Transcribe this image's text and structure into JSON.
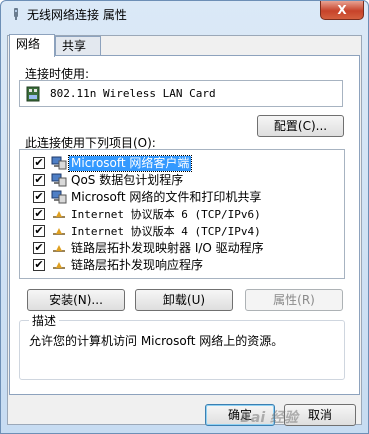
{
  "window": {
    "title": "无线网络连接 属性",
    "close_label": "X"
  },
  "tabs": [
    {
      "label": "网络",
      "active": true
    },
    {
      "label": "共享",
      "active": false
    }
  ],
  "connect_using": {
    "label": "连接时使用:",
    "adapter": "802.11n Wireless LAN Card",
    "configure_button": "配置(C)..."
  },
  "items": {
    "label": "此连接使用下列项目(O):",
    "rows": [
      {
        "text": "Microsoft 网络客户端",
        "checked": true,
        "selected": true,
        "icon": "network-client-icon"
      },
      {
        "text": "QoS 数据包计划程序",
        "checked": true,
        "selected": false,
        "icon": "qos-scheduler-icon"
      },
      {
        "text": "Microsoft 网络的文件和打印机共享",
        "checked": true,
        "selected": false,
        "icon": "file-printer-sharing-icon"
      },
      {
        "text": "Internet 协议版本 6 (TCP/IPv6)",
        "checked": true,
        "selected": false,
        "icon": "protocol-icon"
      },
      {
        "text": "Internet 协议版本 4 (TCP/IPv4)",
        "checked": true,
        "selected": false,
        "icon": "protocol-icon"
      },
      {
        "text": "链路层拓扑发现映射器 I/O 驱动程序",
        "checked": true,
        "selected": false,
        "icon": "protocol-icon"
      },
      {
        "text": "链路层拓扑发现响应程序",
        "checked": true,
        "selected": false,
        "icon": "protocol-icon"
      }
    ]
  },
  "actions": {
    "install": "安装(N)...",
    "uninstall": "卸载(U)",
    "properties": "属性(R)"
  },
  "description": {
    "title": "描述",
    "text": "允许您的计算机访问 Microsoft 网络上的资源。"
  },
  "footer": {
    "ok": "确定",
    "cancel": "取消"
  },
  "watermark": "Bai 经验",
  "colors": {
    "selection": "#3399ff",
    "close_button": "#c7432a",
    "title_bar": "#c7dcf2"
  }
}
